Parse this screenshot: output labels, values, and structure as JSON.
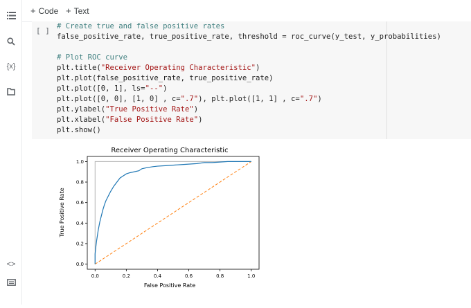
{
  "toolbar": {
    "code_label": "Code",
    "text_label": "Text"
  },
  "sidebar": {
    "items": [
      {
        "icon": "table-of-contents-icon",
        "glyph": "☰"
      },
      {
        "icon": "search-icon",
        "glyph": "⌕"
      },
      {
        "icon": "variables-icon",
        "glyph": "{x}"
      },
      {
        "icon": "folder-icon",
        "glyph": "▭"
      }
    ],
    "bottom": [
      {
        "icon": "code-snippets-icon",
        "glyph": "<>"
      },
      {
        "icon": "terminal-icon",
        "glyph": "▤"
      }
    ]
  },
  "cell": {
    "run_label": "[ ]",
    "code_lines": [
      "# Create true and false positive rates",
      "false_positive_rate, true_positive_rate, threshold = roc_curve(y_test, y_probabilities)",
      "",
      "# Plot ROC curve",
      "plt.title(\"Receiver Operating Characteristic\")",
      "plt.plot(false_positive_rate, true_positive_rate)",
      "plt.plot([0, 1], ls=\"--\")",
      "plt.plot([0, 0], [1, 0] , c=\".7\"), plt.plot([1, 1] , c=\".7\")",
      "plt.ylabel(\"True Positive Rate\")",
      "plt.xlabel(\"False Positive Rate\")",
      "plt.show()"
    ]
  },
  "chart_data": {
    "type": "line",
    "title": "Receiver Operating Characteristic",
    "xlabel": "False Positive Rate",
    "ylabel": "True Positive Rate",
    "xlim": [
      -0.05,
      1.05
    ],
    "ylim": [
      -0.05,
      1.05
    ],
    "xticks": [
      "0.0",
      "0.2",
      "0.4",
      "0.6",
      "0.8",
      "1.0"
    ],
    "yticks": [
      "0.0",
      "0.2",
      "0.4",
      "0.6",
      "0.8",
      "1.0"
    ],
    "grid": false,
    "series": [
      {
        "color": "#1f77b4",
        "style": "solid",
        "x": [
          0,
          0,
          0.005,
          0.01,
          0.015,
          0.02,
          0.025,
          0.03,
          0.04,
          0.05,
          0.06,
          0.07,
          0.08,
          0.09,
          0.1,
          0.12,
          0.14,
          0.16,
          0.18,
          0.2,
          0.22,
          0.25,
          0.28,
          0.3,
          0.33,
          0.37,
          0.4,
          0.45,
          0.5,
          0.55,
          0.6,
          0.65,
          0.7,
          0.75,
          0.8,
          0.85,
          0.9,
          0.95,
          1.0
        ],
        "y": [
          0,
          0.1,
          0.17,
          0.23,
          0.28,
          0.33,
          0.37,
          0.41,
          0.47,
          0.53,
          0.58,
          0.62,
          0.65,
          0.68,
          0.71,
          0.76,
          0.8,
          0.84,
          0.86,
          0.88,
          0.89,
          0.9,
          0.91,
          0.93,
          0.94,
          0.95,
          0.955,
          0.96,
          0.965,
          0.97,
          0.975,
          0.98,
          0.99,
          0.99,
          0.995,
          1.0,
          1.0,
          1.0,
          1.0
        ]
      },
      {
        "color": "#ff7f0e",
        "style": "dashed",
        "x": [
          0,
          1
        ],
        "y": [
          0,
          1
        ]
      },
      {
        "color": "#b3b3b3",
        "style": "solid",
        "x": [
          0,
          0,
          1,
          1
        ],
        "y": [
          0,
          1,
          1,
          1
        ]
      }
    ]
  }
}
